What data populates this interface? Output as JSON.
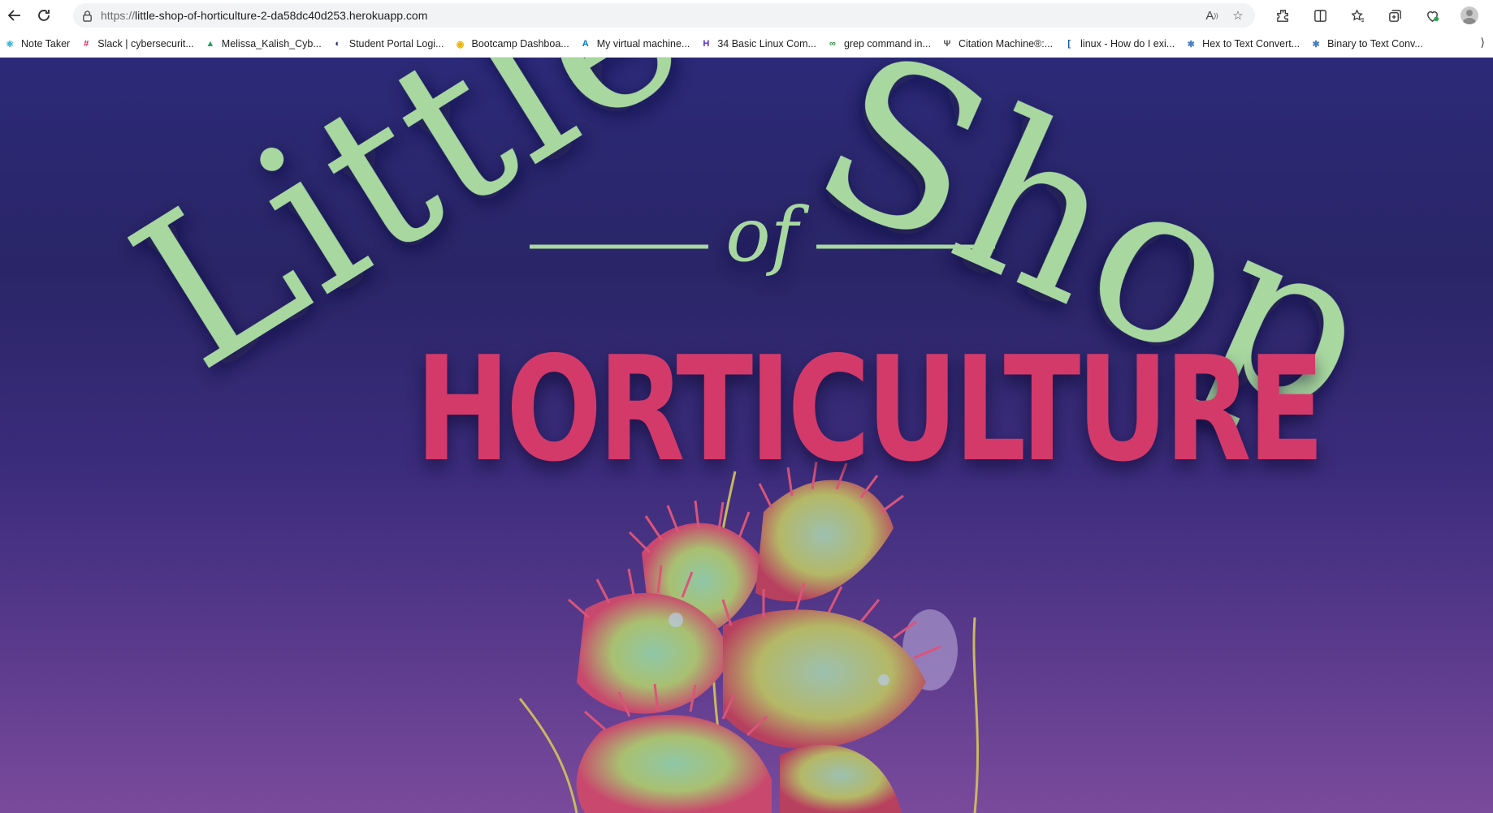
{
  "browser": {
    "url_protocol": "https://",
    "url_host": "little-shop-of-horticulture-2-da58dc40d253.herokuapp.com",
    "bookmarks": [
      {
        "label": "Note Taker",
        "icon": "react-icon",
        "color": "#1aa3c9"
      },
      {
        "label": "Slack | cybersecurit...",
        "icon": "slack-icon",
        "color": "#e01e5a"
      },
      {
        "label": "Melissa_Kalish_Cyb...",
        "icon": "google-drive-icon",
        "color": "#1fa463"
      },
      {
        "label": "Student Portal Logi...",
        "icon": "portal-icon",
        "color": "#2b2a6e"
      },
      {
        "label": "Bootcamp Dashboa...",
        "icon": "bootcamp-icon",
        "color": "#e8b400"
      },
      {
        "label": "My virtual machine...",
        "icon": "azure-icon",
        "color": "#0078d4"
      },
      {
        "label": "34 Basic Linux Com...",
        "icon": "linux-hint-icon",
        "color": "#5a2bd1"
      },
      {
        "label": "grep command in...",
        "icon": "geeks-icon",
        "color": "#2f8d46"
      },
      {
        "label": "Citation Machine®:...",
        "icon": "citation-icon",
        "color": "#555555"
      },
      {
        "label": "linux - How do I exi...",
        "icon": "stackexchange-icon",
        "color": "#1e5aa8"
      },
      {
        "label": "Hex to Text Convert...",
        "icon": "converter-icon",
        "color": "#4a7fc1"
      },
      {
        "label": "Binary to Text Conv...",
        "icon": "converter-icon",
        "color": "#4a7fc1"
      }
    ]
  },
  "hero": {
    "title_word1": "Little",
    "title_word2": "Shop",
    "title_of": "of",
    "subtitle": "HORTICULTURE",
    "title_color": "#a8d8a0",
    "subtitle_color": "#d33a6a"
  }
}
